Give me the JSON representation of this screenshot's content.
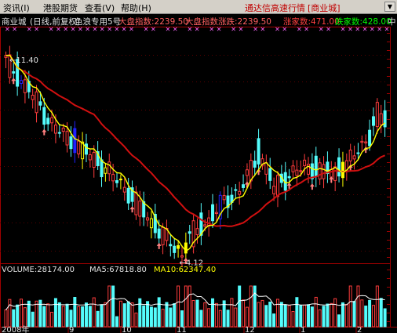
{
  "menubar": {
    "items": [
      "资讯(I)",
      "港股期货",
      "查看(V)",
      "帮助(H)"
    ],
    "service_title": "通达信高速行情",
    "service_bracket": "[商业城]",
    "sys_button": "▼"
  },
  "info_bar": {
    "stock_name": "商业城",
    "period_label": "(日线,前复权)",
    "indicator_label": "色浪专用5号",
    "index_label": "大盘指数:2239.50",
    "index_change_label": "大盘指数涨跌:2239.50",
    "up_count_label": "涨家数:471.00",
    "down_count_label": "跌家数:428.00",
    "mid_marker": "中"
  },
  "price_panel": {
    "high_label": "11.40",
    "low_label": "4.12",
    "high_price": 11.4,
    "low_price": 4.12
  },
  "volume_panel": {
    "volume_label": "VOLUME:28174.00",
    "ma5_label": "MA5:67818.80",
    "ma10_label": "MA10:62347.40"
  },
  "x_axis": {
    "labels": [
      "2008年",
      "9",
      "10",
      "11",
      "12",
      "1",
      "2"
    ]
  },
  "colors": {
    "up": "#ff3c3c",
    "down": "#54fcfc",
    "yellow_candle": "#ffff00",
    "blue_candle": "#2020ff",
    "ma_short": "#ffff00",
    "ma_long": "#d01010",
    "frame": "#a00000",
    "index_text": "#ff6060",
    "up_count_text": "#ff4040",
    "down_count_text": "#00ff00",
    "marker": "#ff66ff"
  }
}
